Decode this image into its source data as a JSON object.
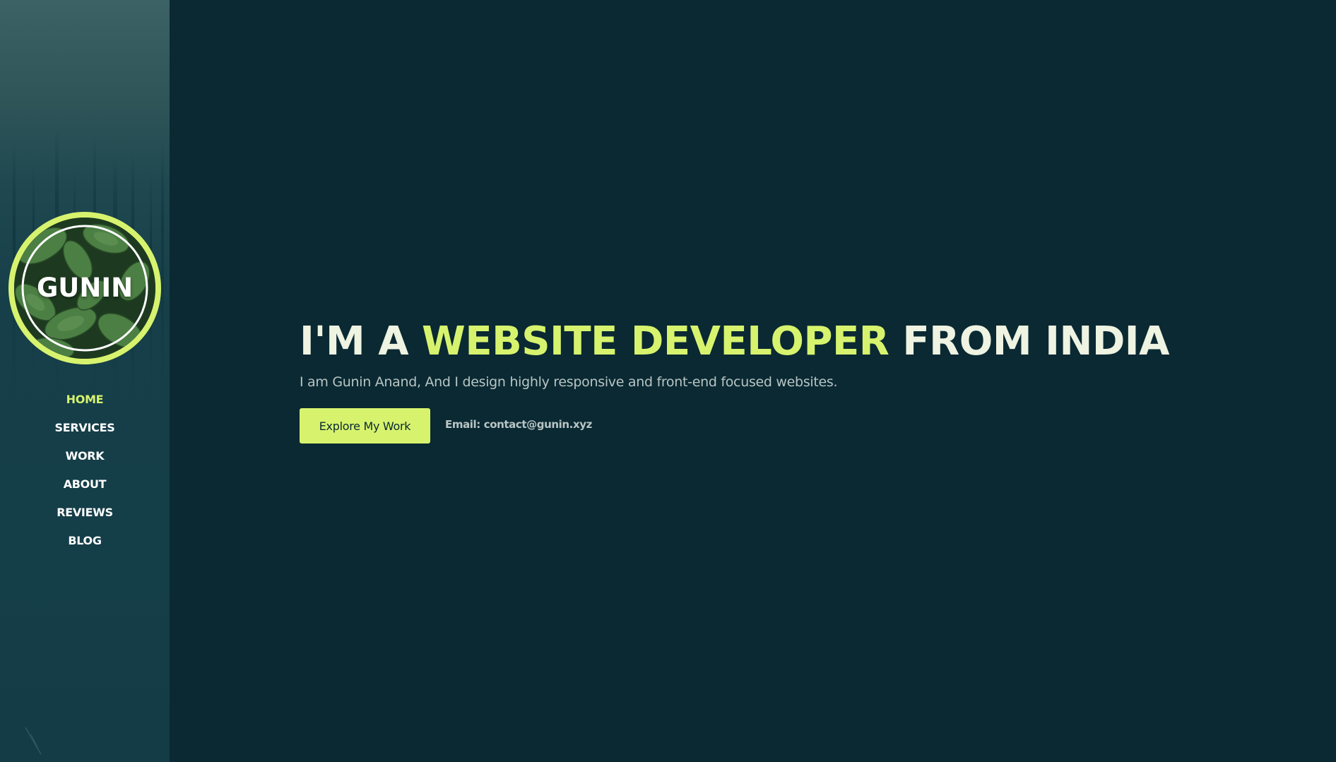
{
  "brand": {
    "logo_text": "GUNIN"
  },
  "nav": {
    "items": [
      {
        "label": "HOME",
        "active": true
      },
      {
        "label": "SERVICES",
        "active": false
      },
      {
        "label": "WORK",
        "active": false
      },
      {
        "label": "ABOUT",
        "active": false
      },
      {
        "label": "REVIEWS",
        "active": false
      },
      {
        "label": "BLOG",
        "active": false
      }
    ]
  },
  "hero": {
    "headline_prefix": "I'M A ",
    "headline_accent": "WEBSITE DEVELOPER",
    "headline_suffix": " FROM INDIA",
    "subline": "I am Gunin Anand, And I design highly responsive and front-end focused websites.",
    "cta_label": "Explore My Work",
    "email_text": "Email: contact@gunin.xyz"
  },
  "colors": {
    "background": "#0a2932",
    "accent": "#d7f36e",
    "sidebar": "#143e48",
    "headline_text": "#eef3e2",
    "body_text": "#b8c5c5"
  },
  "icons": {
    "logo_background": "leaves-image"
  }
}
